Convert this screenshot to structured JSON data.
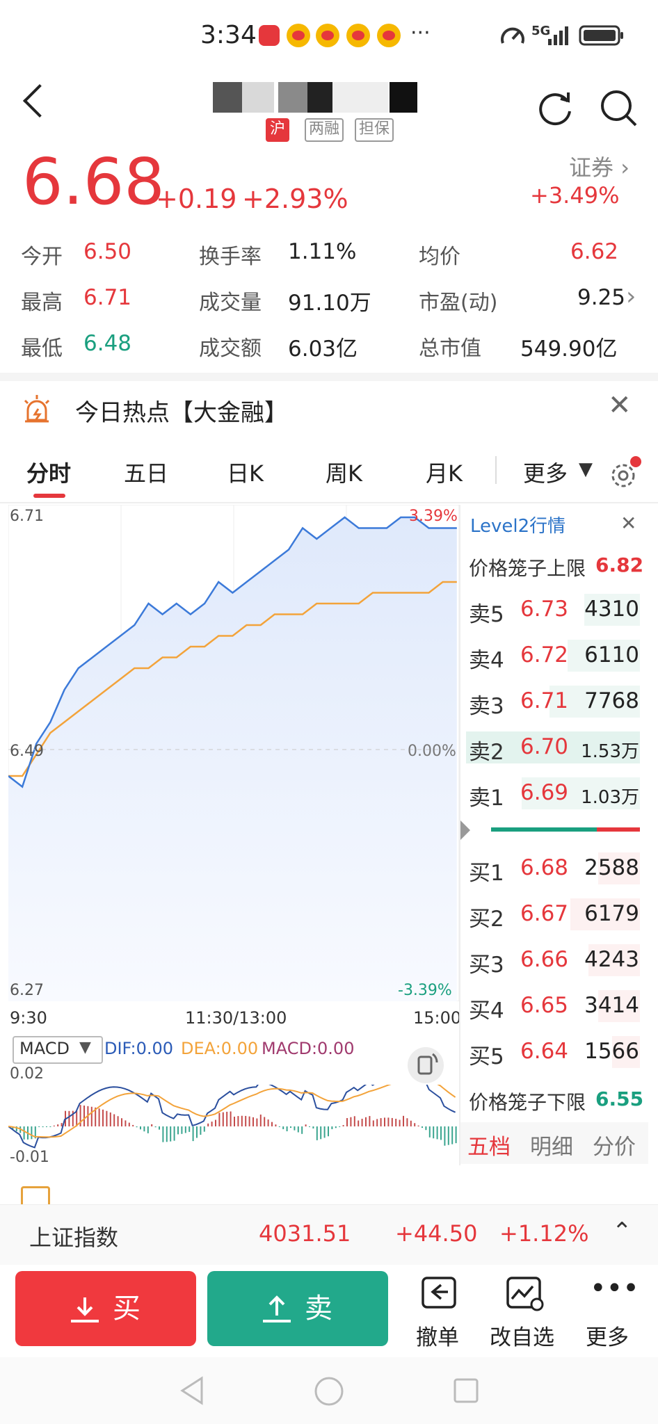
{
  "status_bar": {
    "time": "3:34",
    "signal": "5G"
  },
  "header": {
    "tags": [
      "沪",
      "两融",
      "担保"
    ]
  },
  "quote": {
    "price": "6.68",
    "change": "+0.19",
    "change_pct": "+2.93%",
    "sector_name": "证券",
    "sector_pct": "+3.49%"
  },
  "stats": [
    {
      "label": "今开",
      "value": "6.50",
      "color": "red"
    },
    {
      "label": "换手率",
      "value": "1.11%",
      "color": "plain"
    },
    {
      "label": "均价",
      "value": "6.62",
      "color": "red"
    },
    {
      "label": "最高",
      "value": "6.71",
      "color": "red"
    },
    {
      "label": "成交量",
      "value": "91.10万",
      "color": "plain"
    },
    {
      "label": "市盈(动)",
      "value": "9.25",
      "color": "plain"
    },
    {
      "label": "最低",
      "value": "6.48",
      "color": "green"
    },
    {
      "label": "成交额",
      "value": "6.03亿",
      "color": "plain"
    },
    {
      "label": "总市值",
      "value": "549.90亿",
      "color": "plain"
    }
  ],
  "hot": {
    "text": "今日热点【大金融】"
  },
  "tabs": [
    "分时",
    "五日",
    "日K",
    "周K",
    "月K",
    "更多"
  ],
  "chart": {
    "y_top": "6.71",
    "y_mid": "6.49",
    "y_bottom": "6.27",
    "pct_top": "3.39%",
    "pct_mid": "0.00%",
    "pct_bottom": "-3.39%",
    "times": [
      "9:30",
      "11:30/13:00",
      "15:00"
    ]
  },
  "chart_data": {
    "type": "line",
    "x_range": [
      "9:30",
      "15:00"
    ],
    "ylim": [
      6.27,
      6.71
    ],
    "series": [
      {
        "values": [
          6.47,
          6.46,
          6.5,
          6.52,
          6.55,
          6.57,
          6.58,
          6.59,
          6.6,
          6.61,
          6.63,
          6.62,
          6.63,
          6.62,
          6.63,
          6.65,
          6.64,
          6.65,
          6.66,
          6.67,
          6.68,
          6.7,
          6.69,
          6.7,
          6.71,
          6.7,
          6.7,
          6.7,
          6.71,
          6.71,
          6.7,
          6.7,
          6.7
        ]
      },
      {
        "values": [
          6.47,
          6.47,
          6.49,
          6.51,
          6.52,
          6.53,
          6.54,
          6.55,
          6.56,
          6.57,
          6.57,
          6.58,
          6.58,
          6.59,
          6.59,
          6.6,
          6.6,
          6.61,
          6.61,
          6.62,
          6.62,
          6.62,
          6.63,
          6.63,
          6.63,
          6.63,
          6.64,
          6.64,
          6.64,
          6.64,
          6.64,
          6.65,
          6.65
        ]
      }
    ]
  },
  "macd": {
    "selector": "MACD",
    "dif": "DIF:0.00",
    "dea": "DEA:0.00",
    "macd": "MACD:0.00",
    "y_top": "0.02",
    "y_bottom": "-0.01"
  },
  "orderbook": {
    "title": "Level2行情",
    "upper_limit_label": "价格笼子上限",
    "upper_limit": "6.82",
    "asks": [
      {
        "label": "卖5",
        "price": "6.73",
        "vol": "4310"
      },
      {
        "label": "卖4",
        "price": "6.72",
        "vol": "6110"
      },
      {
        "label": "卖3",
        "price": "6.71",
        "vol": "7768"
      },
      {
        "label": "卖2",
        "price": "6.70",
        "vol": "1.53万"
      },
      {
        "label": "卖1",
        "price": "6.69",
        "vol": "1.03万"
      }
    ],
    "bids": [
      {
        "label": "买1",
        "price": "6.68",
        "vol": "2588"
      },
      {
        "label": "买2",
        "price": "6.67",
        "vol": "6179"
      },
      {
        "label": "买3",
        "price": "6.66",
        "vol": "4243"
      },
      {
        "label": "买4",
        "price": "6.65",
        "vol": "3414"
      },
      {
        "label": "买5",
        "price": "6.64",
        "vol": "1566"
      }
    ],
    "lower_limit_label": "价格笼子下限",
    "lower_limit": "6.55",
    "tabs": [
      "五档",
      "明细",
      "分价"
    ]
  },
  "index": {
    "name": "上证指数",
    "value": "4031.51",
    "change": "+44.50",
    "pct": "+1.12%"
  },
  "actions": {
    "buy": "买",
    "sell": "卖",
    "cancel": "撤单",
    "watch": "改自选",
    "more": "更多"
  }
}
